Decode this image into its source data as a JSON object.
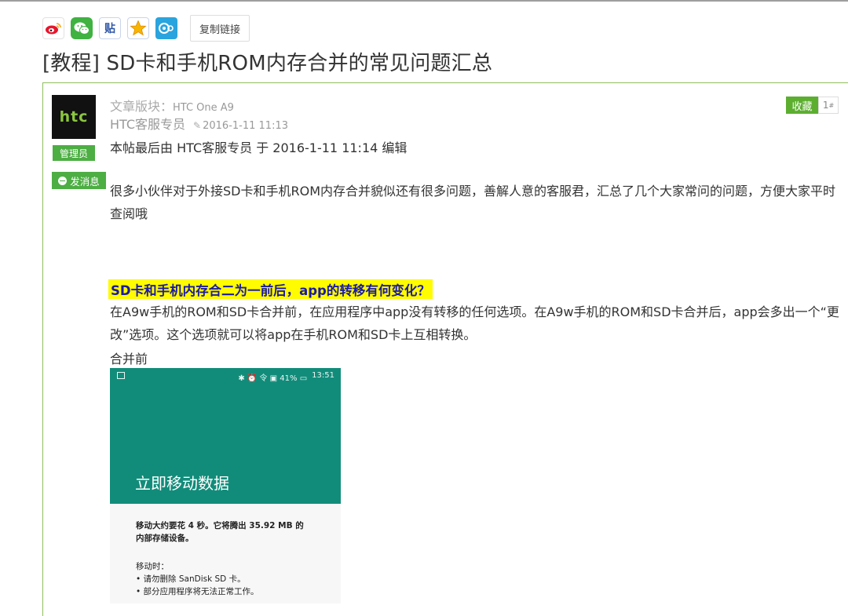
{
  "share": {
    "icons": [
      "weibo-icon",
      "wechat-icon",
      "tieba-icon",
      "star-icon",
      "qzone-icon"
    ],
    "tieba_glyph": "贴",
    "copy_link_label": "复制链接"
  },
  "thread": {
    "title": "[教程] SD卡和手机ROM内存合并的常见问题汇总"
  },
  "author_panel": {
    "avatar_text": "htc",
    "role_badge": "管理员",
    "message_button": "发消息"
  },
  "meta": {
    "board_label": "文章版块：",
    "board_name": "HTC One A9",
    "author": "HTC客服专员",
    "post_time": "2016-1-11 11:13",
    "favorite_label": "收藏",
    "floor_number": "1",
    "floor_suffix": "#"
  },
  "post": {
    "edit_note": "本帖最后由 HTC客服专员 于 2016-1-11 11:14 编辑",
    "intro": "很多小伙伴对于外接SD卡和手机ROM内存合并貌似还有很多问题，善解人意的客服君，汇总了几个大家常问的问题，方便大家平时查阅哦",
    "section_heading": "SD卡和手机内存合二为一前后，app的转移有何变化？",
    "section_body": "在A9w手机的ROM和SD卡合并前，在应用程序中app没有转移的任何选项。在A9w手机的ROM和SD卡合并后，app会多出一个“更改”选项。这个选项就可以将app在手机ROM和SD卡上互相转换。",
    "before_label": "合并前"
  },
  "screenshot": {
    "status_icons": "✱ ⏰ 令 ▣ 41% ▭",
    "status_time": "13:51",
    "title": "立即移动数据",
    "line1": "移动大约要花 4 秒。它将腾出 35.92 MB 的",
    "line2": "内部存储设备。",
    "line3": "移动时：",
    "line4": "• 请勿删除 SanDisk SD 卡。",
    "line5": "• 部分应用程序将无法正常工作。"
  },
  "colors": {
    "accent_green": "#4cae43",
    "highlight_yellow": "#fffb00",
    "highlight_text": "#1a1aa6",
    "phone_teal": "#128c7a"
  }
}
